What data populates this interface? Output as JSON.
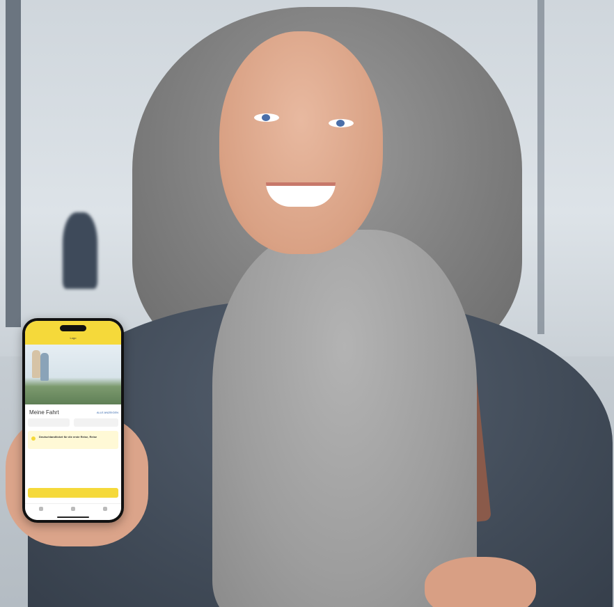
{
  "scene": {
    "description_colors": {
      "coat": "#414b58",
      "scarf": "#9d9d9d",
      "phone_accent": "#f5d93a"
    }
  },
  "phone_app": {
    "header_title": "Logo",
    "section_title": "Meine Fahrt",
    "section_link": "ALLE ANZEIGEN",
    "field_left": "",
    "field_right": "",
    "info_title": "Deutschlandticket für die erste Reise, Reise",
    "info_sub": "",
    "fine_print": "",
    "cta_label": "",
    "tabs": [
      {
        "label": "",
        "icon": "home-icon"
      },
      {
        "label": "",
        "icon": "ticket-icon"
      },
      {
        "label": "",
        "icon": "menu-icon"
      }
    ]
  }
}
